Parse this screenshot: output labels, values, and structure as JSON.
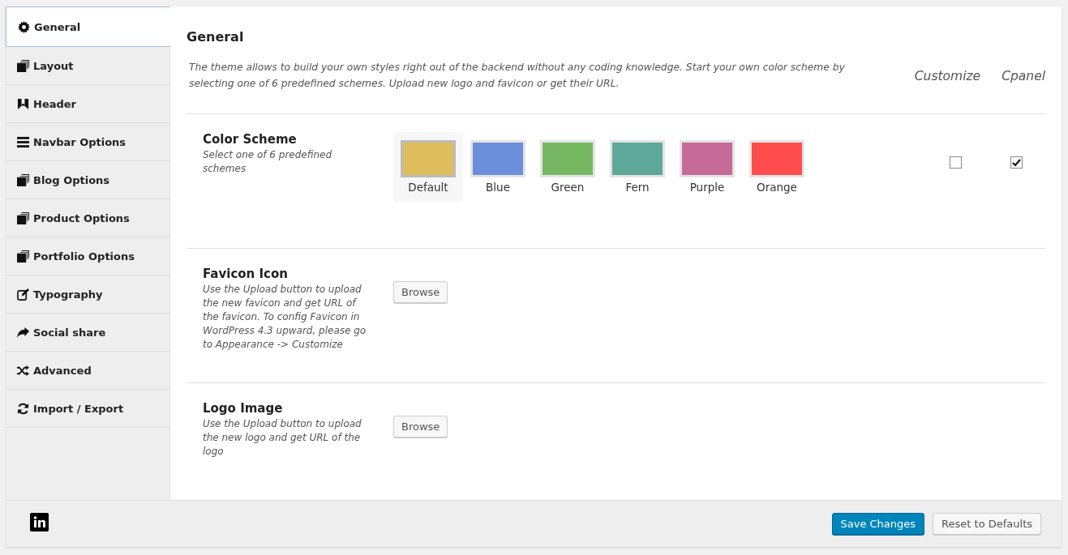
{
  "sidebar": {
    "items": [
      {
        "label": "General",
        "selected": true
      },
      {
        "label": "Layout",
        "selected": false
      },
      {
        "label": "Header",
        "selected": false
      },
      {
        "label": "Navbar Options",
        "selected": false
      },
      {
        "label": "Blog Options",
        "selected": false
      },
      {
        "label": "Product Options",
        "selected": false
      },
      {
        "label": "Portfolio Options",
        "selected": false
      },
      {
        "label": "Typography",
        "selected": false
      },
      {
        "label": "Social share",
        "selected": false
      },
      {
        "label": "Advanced",
        "selected": false
      },
      {
        "label": "Import / Export",
        "selected": false
      }
    ]
  },
  "section": {
    "title": "General",
    "description": "The theme allows to build your own styles right out of the backend without any coding knowledge. Start your own color scheme by selecting one of 6 predefined schemes. Upload new logo and favicon or get their URL.",
    "columns": [
      "Customize",
      "Cpanel"
    ]
  },
  "options": [
    {
      "kind": "swatches",
      "title": "Color Scheme",
      "description": "Select one of 6 predefined schemes",
      "swatches": [
        {
          "label": "Default",
          "color": "#ddbd5c",
          "selected": true
        },
        {
          "label": "Blue",
          "color": "#6b8fd8",
          "selected": false
        },
        {
          "label": "Green",
          "color": "#76b861",
          "selected": false
        },
        {
          "label": "Fern",
          "color": "#5ea99a",
          "selected": false
        },
        {
          "label": "Purple",
          "color": "#c56b97",
          "selected": false
        },
        {
          "label": "Orange",
          "color": "#ff4c4c",
          "selected": false
        }
      ],
      "checks": [
        {
          "checked": false
        },
        {
          "checked": true
        }
      ]
    },
    {
      "kind": "upload",
      "title": "Favicon Icon",
      "description": "Use the Upload button to upload the new favicon and get URL of the favicon. To config Favicon in WordPress 4.3 upward, please go to Appearance -> Customize",
      "button": "Browse"
    },
    {
      "kind": "upload",
      "title": "Logo Image",
      "description": "Use the Upload button to upload the new logo and get URL of the logo",
      "button": "Browse"
    }
  ],
  "footer": {
    "buttons": [
      {
        "label": "Save Changes",
        "kind": "primary"
      },
      {
        "label": "Reset to Defaults",
        "kind": "secondary"
      }
    ]
  }
}
